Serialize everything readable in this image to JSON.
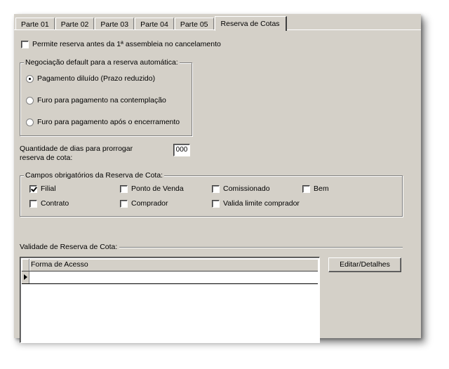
{
  "tabs": [
    {
      "label": "Parte 01",
      "active": false
    },
    {
      "label": "Parte 02",
      "active": false
    },
    {
      "label": "Parte 03",
      "active": false
    },
    {
      "label": "Parte 04",
      "active": false
    },
    {
      "label": "Parte 05",
      "active": false
    },
    {
      "label": "Reserva de Cotas",
      "active": true
    }
  ],
  "permite_reserva": {
    "label": "Permite reserva antes da 1ª assembleia no cancelamento",
    "checked": false
  },
  "negociacao": {
    "legend": "Negociação default para a reserva automática:",
    "options": [
      {
        "label": "Pagamento diluído (Prazo reduzido)",
        "selected": true
      },
      {
        "label": "Furo para pagamento na contemplação",
        "selected": false
      },
      {
        "label": "Furo para pagamento após o encerramento",
        "selected": false
      }
    ]
  },
  "dias": {
    "label_line1": "Quantidade de dias para prorrogar",
    "label_line2": "reserva de cota:",
    "value": "000"
  },
  "campos": {
    "legend": "Campos obrigatórios da Reserva de Cota:",
    "items": [
      {
        "label": "Filial",
        "checked": true
      },
      {
        "label": "Ponto de Venda",
        "checked": false
      },
      {
        "label": "Comissionado",
        "checked": false
      },
      {
        "label": "Bem",
        "checked": false
      },
      {
        "label": "Contrato",
        "checked": false
      },
      {
        "label": "Comprador",
        "checked": false
      },
      {
        "label": "Valida limite comprador",
        "checked": false
      }
    ]
  },
  "validade": {
    "label": "Validade de Reserva de Cota:",
    "column": "Forma de Acesso"
  },
  "editar_button": "Editar/Detalhes"
}
